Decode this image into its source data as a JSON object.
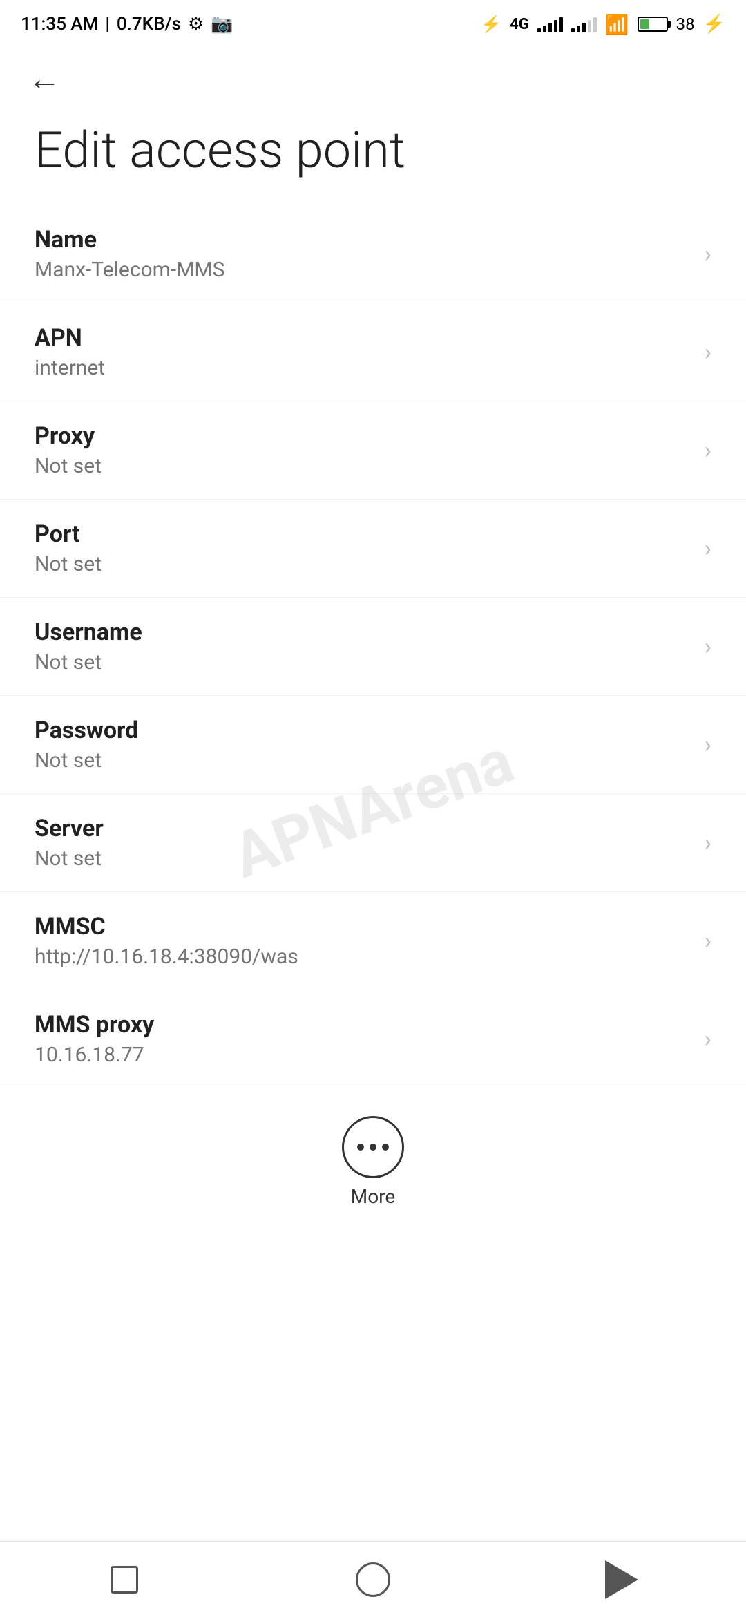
{
  "statusBar": {
    "time": "11:35 AM",
    "speed": "0.7KB/s",
    "batteryPercent": "38"
  },
  "navigation": {
    "backLabel": "←"
  },
  "pageTitle": "Edit access point",
  "settings": [
    {
      "id": "name",
      "label": "Name",
      "value": "Manx-Telecom-MMS"
    },
    {
      "id": "apn",
      "label": "APN",
      "value": "internet"
    },
    {
      "id": "proxy",
      "label": "Proxy",
      "value": "Not set"
    },
    {
      "id": "port",
      "label": "Port",
      "value": "Not set"
    },
    {
      "id": "username",
      "label": "Username",
      "value": "Not set"
    },
    {
      "id": "password",
      "label": "Password",
      "value": "Not set"
    },
    {
      "id": "server",
      "label": "Server",
      "value": "Not set"
    },
    {
      "id": "mmsc",
      "label": "MMSC",
      "value": "http://10.16.18.4:38090/was"
    },
    {
      "id": "mms-proxy",
      "label": "MMS proxy",
      "value": "10.16.18.77"
    }
  ],
  "more": {
    "label": "More"
  },
  "watermark": "APNArena"
}
